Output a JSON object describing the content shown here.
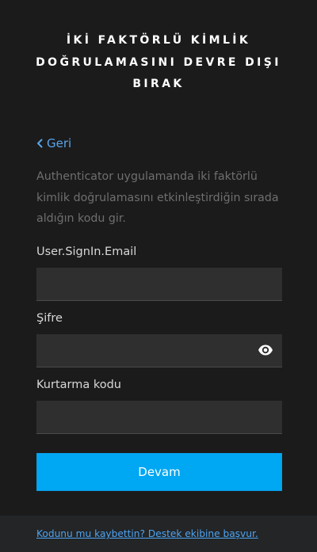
{
  "header": {
    "title_line1": "İKİ FAKTÖRLÜ KİMLİK",
    "title_line2": "DOĞRULAMASINI DEVRE DIŞI",
    "title_line3": "BIRAK"
  },
  "back": {
    "label": "Geri",
    "icon": "chevron-left-icon"
  },
  "description": "Authenticator uygulamanda iki faktörlü kimlik doğrulamasını etkinleştirdiğin sırada aldığın kodu gir.",
  "form": {
    "email": {
      "label": "User.SignIn.Email",
      "value": "",
      "placeholder": ""
    },
    "password": {
      "label": "Şifre",
      "value": "",
      "placeholder": "",
      "toggle_icon": "eye-icon"
    },
    "recovery_code": {
      "label": "Kurtarma kodu",
      "value": "",
      "placeholder": ""
    },
    "submit_label": "Devam"
  },
  "footer": {
    "help_link": "Kodunu mu kaybettin? Destek ekibine başvur."
  },
  "colors": {
    "background": "#1b1b1c",
    "field": "#2f2f30",
    "accent": "#00a7f3",
    "link": "#5aa5e8",
    "footer": "#232527"
  }
}
